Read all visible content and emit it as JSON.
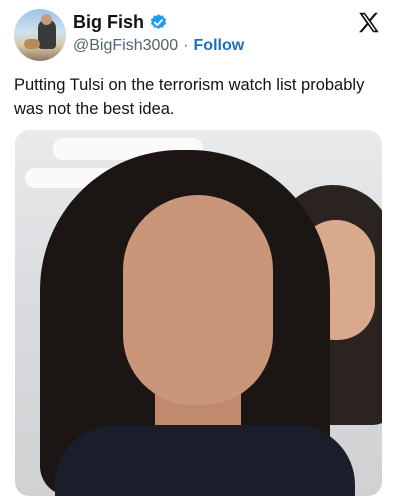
{
  "post": {
    "author": {
      "display_name": "Big Fish",
      "handle": "@BigFish3000",
      "verified": true
    },
    "separator": "·",
    "follow_label": "Follow",
    "platform_icon": "x-logo-icon",
    "text": "Putting Tulsi on the terrorism watch list probably was not the best idea.",
    "colors": {
      "verified_badge": "#1d9bf0",
      "follow_link": "#1d70b8",
      "handle": "#536471"
    }
  }
}
